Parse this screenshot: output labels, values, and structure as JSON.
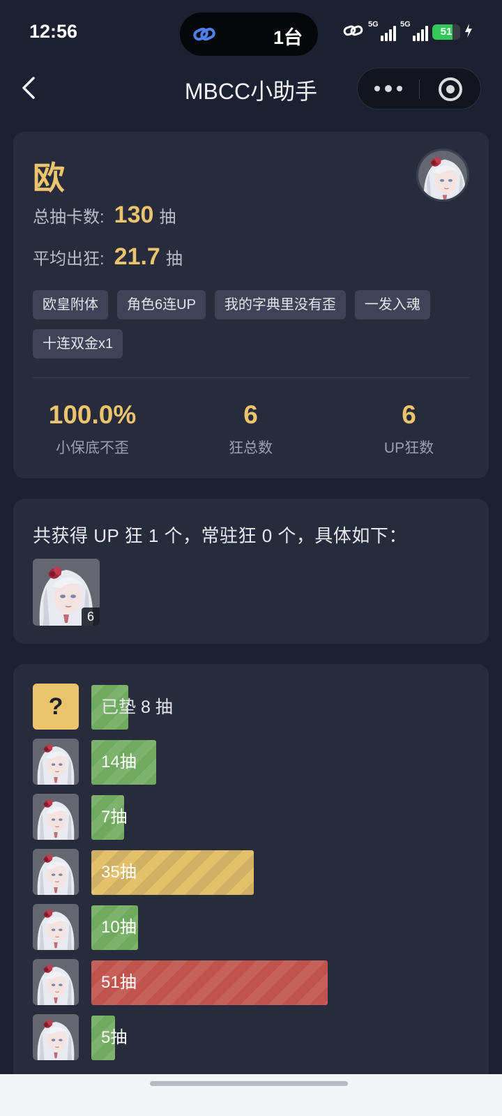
{
  "status_bar": {
    "time": "12:56",
    "island_text": "1台",
    "network1": "5G",
    "network2": "5G",
    "battery": "51"
  },
  "nav": {
    "title": "MBCC小助手"
  },
  "profile": {
    "rank": "欧",
    "total_label": "总抽卡数:",
    "total_value": "130",
    "total_unit": "抽",
    "avg_label": "平均出狂:",
    "avg_value": "21.7",
    "avg_unit": "抽",
    "tags": [
      "欧皇附体",
      "角色6连UP",
      "我的字典里没有歪",
      "一发入魂",
      "十连双金x1"
    ],
    "metrics": [
      {
        "value": "100.0%",
        "label": "小保底不歪"
      },
      {
        "value": "6",
        "label": "狂总数"
      },
      {
        "value": "6",
        "label": "UP狂数"
      }
    ]
  },
  "summary": {
    "text": "共获得 UP 狂 1 个，常驻狂 0 个，具体如下：",
    "characters": [
      {
        "count": "6"
      }
    ]
  },
  "history": {
    "pending_icon": "?",
    "pending_label": "已垫 8 抽",
    "pending_pulls": 8,
    "max_pulls": 80,
    "pulls": [
      {
        "label": "14抽",
        "pulls": 14,
        "color": "green"
      },
      {
        "label": "7抽",
        "pulls": 7,
        "color": "green"
      },
      {
        "label": "35抽",
        "pulls": 35,
        "color": "gold"
      },
      {
        "label": "10抽",
        "pulls": 10,
        "color": "green"
      },
      {
        "label": "51抽",
        "pulls": 51,
        "color": "red"
      },
      {
        "label": "5抽",
        "pulls": 5,
        "color": "green"
      }
    ]
  },
  "colors": {
    "accent_gold": "#ebc46d",
    "bar_green": "#6faa5e",
    "bar_gold": "#e2c06c",
    "bar_red": "#c0544c",
    "card_bg": "#272b3c",
    "page_bg": "#1c2030"
  },
  "icons": {
    "back": "chevron-left-icon",
    "more": "more-dots-icon",
    "close": "target-close-icon",
    "link": "link-icon",
    "character": "character-portrait-icon"
  }
}
